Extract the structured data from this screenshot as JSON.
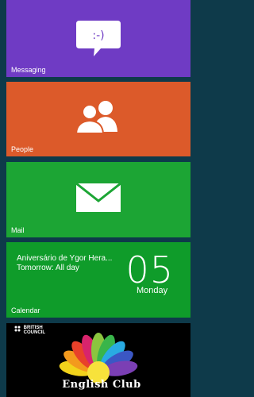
{
  "tiles": {
    "messaging": {
      "label": "Messaging",
      "icon": "speech-bubble-icon",
      "icon_text": ":-)",
      "color": "#6f3bc4"
    },
    "people": {
      "label": "People",
      "icon": "people-icon",
      "color": "#dc5a2a"
    },
    "mail": {
      "label": "Mail",
      "icon": "envelope-icon",
      "color": "#1ca534"
    },
    "calendar": {
      "label": "Calendar",
      "event_title": "Aniversário de Ygor Hera...",
      "event_time": "Tomorrow: All day",
      "day_number": "05",
      "weekday": "Monday",
      "color": "#0f9c2a"
    },
    "english_club": {
      "brand_line1": "BRITISH",
      "brand_line2": "COUNCIL",
      "title": "English Club",
      "logo": "rainbow-flower-logo"
    }
  }
}
